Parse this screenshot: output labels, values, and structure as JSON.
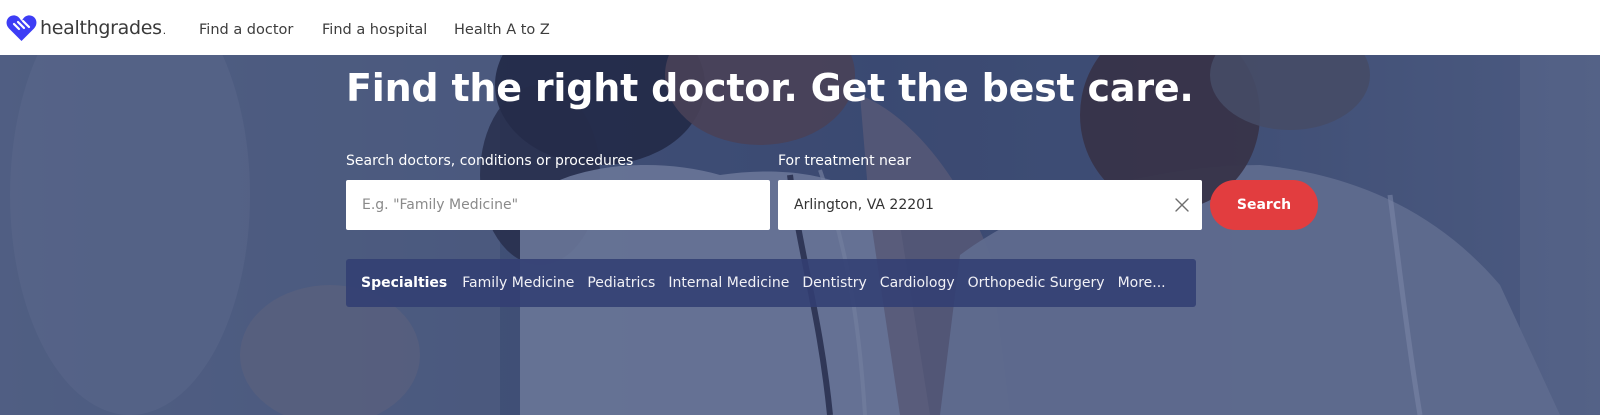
{
  "brand": {
    "name": "healthgrades",
    "color": "#3d3df5"
  },
  "nav": {
    "links": [
      "Find a doctor",
      "Find a hospital",
      "Health A to Z"
    ]
  },
  "hero": {
    "headline": "Find the right doctor. Get the best care.",
    "search": {
      "query_label": "Search doctors, conditions or procedures",
      "query_placeholder": "E.g. \"Family Medicine\"",
      "query_value": "",
      "location_label": "For treatment near",
      "location_value": "Arlington, VA 22201",
      "clear_icon": "close-icon",
      "button_label": "Search",
      "button_color": "#e23d3f"
    },
    "specialties": {
      "title": "Specialties",
      "items": [
        "Family Medicine",
        "Pediatrics",
        "Internal Medicine",
        "Dentistry",
        "Cardiology",
        "Orthopedic Surgery",
        "More..."
      ]
    }
  }
}
